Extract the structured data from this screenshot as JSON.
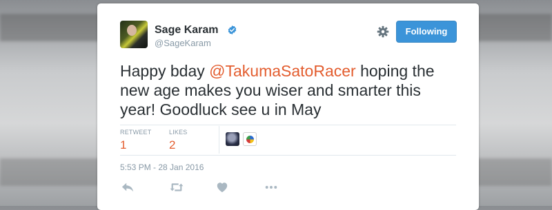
{
  "tweet": {
    "author_name": "Sage Karam",
    "author_handle": "@SageKaram",
    "follow_label": "Following",
    "text_before": "Happy bday ",
    "mention": "@TakumaSatoRacer",
    "text_after": " hoping the new age makes you wiser and smarter this year! Goodluck see u in May",
    "stats": {
      "retweet_label": "RETWEET",
      "retweet_count": "1",
      "likes_label": "LIKES",
      "likes_count": "2"
    },
    "timestamp": "5:53 PM - 28 Jan 2016"
  },
  "icons": {
    "verified": "verified-badge-icon",
    "settings": "gear-icon",
    "reply": "reply-icon",
    "retweet": "retweet-icon",
    "like": "heart-icon",
    "more": "more-dots-icon"
  },
  "colors": {
    "accent": "#3b94d9",
    "mention": "#e35d2f",
    "muted": "#8899a6",
    "text": "#292f33"
  }
}
